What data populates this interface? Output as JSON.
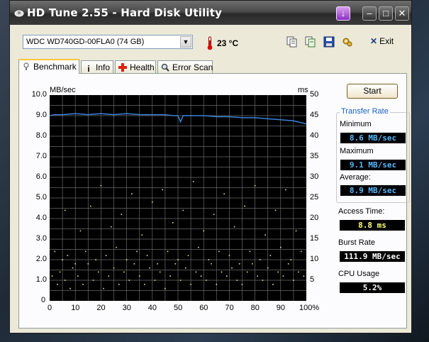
{
  "window": {
    "title": "HD Tune 2.55 - Hard Disk Utility"
  },
  "toolbar": {
    "drive": "WDC WD740GD-00FLA0 (74 GB)",
    "temperature": "23 °C",
    "exit_label": "Exit"
  },
  "tabs": [
    {
      "label": "Benchmark",
      "icon": "benchmark-icon",
      "active": true
    },
    {
      "label": "Info",
      "icon": "info-icon",
      "active": false
    },
    {
      "label": "Health",
      "icon": "health-icon",
      "active": false
    },
    {
      "label": "Error Scan",
      "icon": "error-scan-icon",
      "active": false
    }
  ],
  "benchmark": {
    "start_label": "Start",
    "transfer_rate_title": "Transfer Rate",
    "minimum_label": "Minimum",
    "minimum_value": "8.6 MB/sec",
    "maximum_label": "Maximum",
    "maximum_value": "9.1 MB/sec",
    "average_label": "Average:",
    "average_value": "8.9 MB/sec",
    "access_label": "Access Time:",
    "access_value": "8.8 ms",
    "burst_label": "Burst Rate",
    "burst_value": "111.9 MB/sec",
    "cpu_label": "CPU Usage",
    "cpu_value": "5.2%",
    "colors": {
      "transfer_box_text": "#55b8ff",
      "access_box_text": "#ffff7a",
      "white_box_text": "#ffffff",
      "line": "#3a82d8",
      "dots": "#e6e67a",
      "grid": "#6a6a6a"
    }
  },
  "chart_data": {
    "type": "line",
    "left_unit": "MB/sec",
    "right_unit": "ms",
    "left_ticks": [
      "10.0",
      "9.0",
      "8.0",
      "7.0",
      "6.0",
      "5.0",
      "4.0",
      "3.0",
      "2.0",
      "1.0"
    ],
    "right_ticks": [
      "50",
      "45",
      "40",
      "35",
      "30",
      "25",
      "20",
      "15",
      "10",
      "5"
    ],
    "x_ticks": [
      "0",
      "10",
      "20",
      "30",
      "40",
      "50",
      "60",
      "70",
      "80",
      "90",
      "100%"
    ],
    "ylim_left": [
      0,
      10
    ],
    "ylim_right": [
      0,
      50
    ],
    "xlim": [
      0,
      100
    ],
    "series": [
      {
        "axis": "left",
        "style": "line",
        "x": [
          0,
          2,
          5,
          10,
          15,
          20,
          25,
          30,
          35,
          40,
          45,
          48,
          50,
          51,
          52,
          55,
          60,
          65,
          70,
          75,
          80,
          85,
          90,
          95,
          100
        ],
        "y": [
          9.0,
          9.05,
          9.05,
          9.1,
          9.05,
          9.1,
          9.05,
          9.1,
          9.05,
          9.05,
          9.05,
          9.0,
          9.0,
          8.7,
          9.0,
          9.0,
          9.0,
          8.95,
          8.95,
          8.9,
          8.9,
          8.85,
          8.8,
          8.75,
          8.6
        ]
      },
      {
        "axis": "right",
        "style": "scatter",
        "x": [
          1,
          3,
          4,
          6,
          8,
          9,
          11,
          13,
          15,
          17,
          19,
          21,
          23,
          25,
          27,
          29,
          31,
          33,
          35,
          37,
          39,
          41,
          43,
          45,
          47,
          49,
          51,
          53,
          55,
          57,
          59,
          61,
          63,
          65,
          67,
          69,
          71,
          73,
          75,
          77,
          79,
          81,
          83,
          85,
          87,
          89,
          91,
          93,
          95,
          97,
          99,
          2,
          5,
          7,
          10,
          14,
          18,
          22,
          26,
          30,
          34,
          38,
          42,
          46,
          50,
          54,
          58,
          62,
          66,
          70,
          74,
          78,
          82,
          86,
          90,
          94,
          98,
          12,
          24,
          36,
          48,
          60,
          72,
          84,
          96,
          6,
          16,
          28,
          40,
          52,
          64,
          76,
          88,
          20,
          44,
          56,
          68,
          80,
          92,
          32
        ],
        "y": [
          6,
          4,
          7,
          5,
          3,
          8,
          6,
          4,
          9,
          5,
          7,
          3,
          6,
          8,
          4,
          7,
          5,
          9,
          6,
          4,
          8,
          5,
          7,
          3,
          6,
          9,
          5,
          8,
          4,
          7,
          6,
          5,
          9,
          4,
          7,
          6,
          8,
          5,
          4,
          7,
          9,
          6,
          5,
          8,
          4,
          7,
          6,
          9,
          5,
          7,
          6,
          12,
          10,
          11,
          9,
          12,
          10,
          11,
          13,
          10,
          12,
          11,
          9,
          12,
          10,
          11,
          13,
          10,
          12,
          11,
          9,
          12,
          10,
          11,
          13,
          10,
          12,
          17,
          18,
          16,
          19,
          17,
          18,
          16,
          17,
          22,
          23,
          21,
          24,
          22,
          21,
          23,
          22,
          28,
          27,
          29,
          26,
          28,
          27,
          26
        ]
      }
    ]
  }
}
